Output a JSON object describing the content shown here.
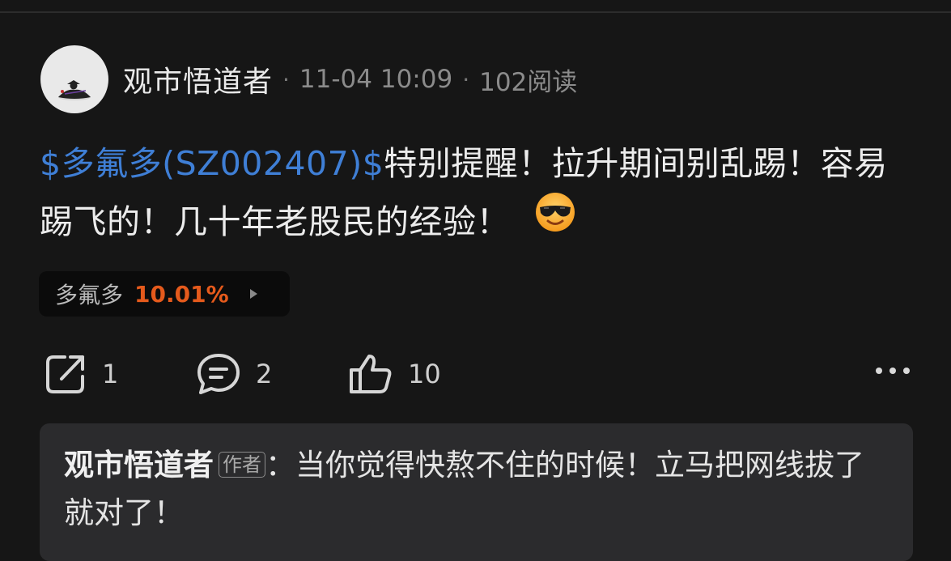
{
  "post": {
    "author": "观市悟道者",
    "separator": "·",
    "time": "11-04 10:09",
    "views": "102阅读",
    "stock_link": "$多氟多(SZ002407)$",
    "content": "特别提醒！拉升期间别乱踢！容易踢飞的！几十年老股民的经验！",
    "emoji": "cool-sunglasses-emoji"
  },
  "stock_tag": {
    "name": "多氟多",
    "change": "10.01%",
    "change_color": "#e55a1c"
  },
  "actions": {
    "share_count": "1",
    "comment_count": "2",
    "like_count": "10"
  },
  "reply": {
    "author": "观市悟道者",
    "badge": "作者",
    "colon": "：",
    "text": "当你觉得快熬不住的时候！立马把网线拔了就对了！"
  },
  "colors": {
    "background": "#161616",
    "link": "#3f7fd6",
    "card": "#2b2b2d"
  }
}
